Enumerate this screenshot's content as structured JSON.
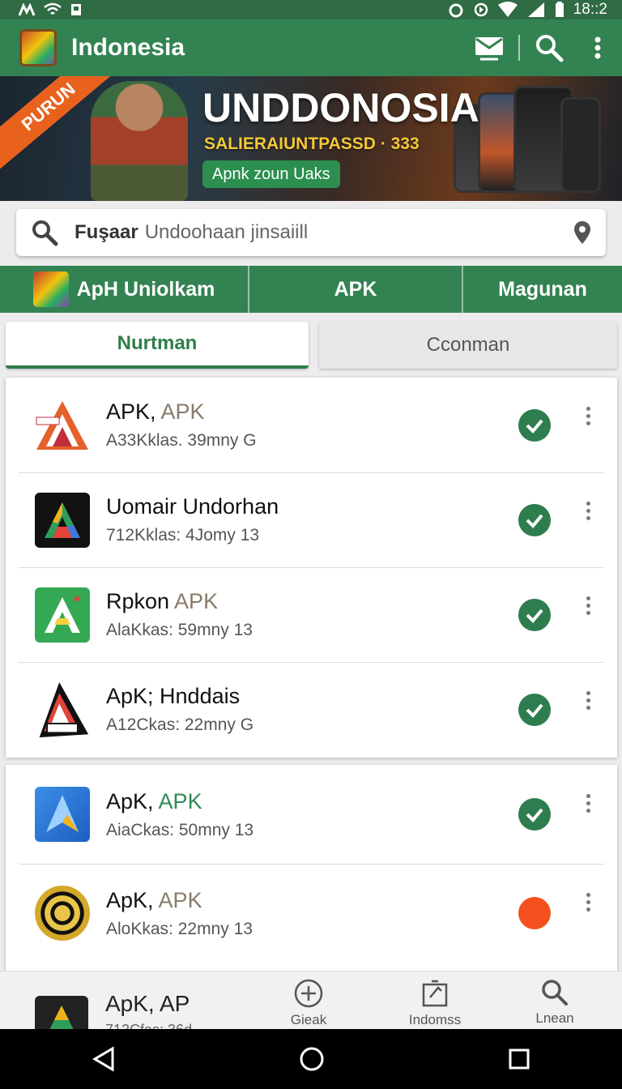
{
  "status_bar": {
    "time": "18::2"
  },
  "app_bar": {
    "title": "Indonesia"
  },
  "banner": {
    "ribbon": "PURUN",
    "headline": "UNDDONOSIA",
    "subline": "SALIERAIUNTPASSD · 333",
    "cta": "Apnk zoun Uaks"
  },
  "search": {
    "query": "Fuşaar",
    "placeholder": "Undoohaan jinsaiill"
  },
  "category_tabs": [
    {
      "label": "ApH Uniolkam"
    },
    {
      "label": "APK"
    },
    {
      "label": "Magunan"
    }
  ],
  "segments": {
    "active": "Nurtman",
    "inactive": "Cconman"
  },
  "apps": [
    {
      "name": "APK,",
      "name_extra": "APK",
      "meta": "A33Kklas. 39mny  G",
      "status": "installed"
    },
    {
      "name": "Uomair Undorhan",
      "name_extra": "",
      "meta": "712Kklas: 4Jomy  13",
      "status": "installed"
    },
    {
      "name": "Rpkon",
      "name_extra": "APK",
      "meta": "AlaKkas: 59mny  13",
      "status": "installed"
    },
    {
      "name": "ApK; Hnddais",
      "name_extra": "",
      "meta": "A12Ckas: 22mny  G",
      "status": "installed"
    },
    {
      "name": "ApK,",
      "name_extra": "APK",
      "meta": "AiaCkas: 50mny  13",
      "status": "installed"
    },
    {
      "name": "ApK,",
      "name_extra": "APK",
      "meta": "AloKkas: 22mny  13",
      "status": "pending"
    }
  ],
  "peek_item": {
    "name": "ApK, AP",
    "meta": "712Cfas: 36d"
  },
  "bottom_nav": [
    {
      "label": "Gieak",
      "icon": "add-circle-icon"
    },
    {
      "label": "Indomss",
      "icon": "edit-box-icon"
    },
    {
      "label": "Lnean",
      "icon": "search-icon"
    }
  ],
  "colors": {
    "primary": "#338352",
    "status_bar": "#2f6b43",
    "installed": "#2e7d4f",
    "pending": "#f4511e",
    "accent_text": "#2f7c4b"
  }
}
